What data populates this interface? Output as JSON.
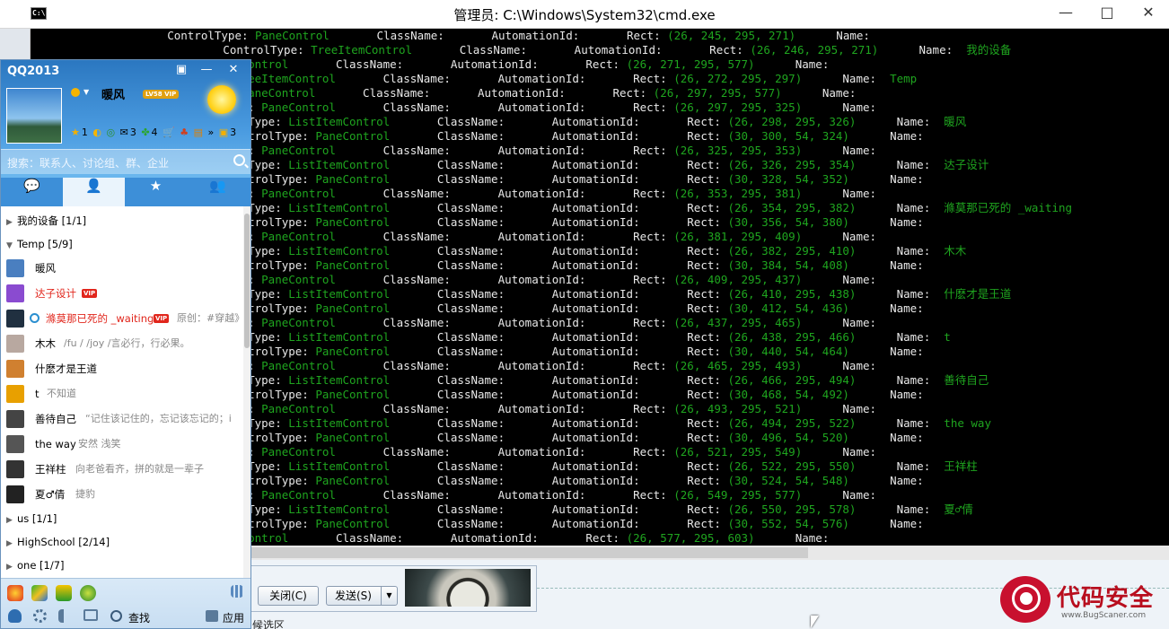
{
  "cmd": {
    "title": "管理员: C:\\Windows\\System32\\cmd.exe",
    "icon_text": "C:\\.",
    "minimize": "—",
    "maximize": "□",
    "close": "✕",
    "lines": [
      [
        [
          "w",
          "        ControlType: "
        ],
        [
          "g",
          "PaneControl"
        ],
        [
          "w",
          "       ClassName:       AutomationId:       Rect: "
        ],
        [
          "g",
          "(26, 245, 295, 271)"
        ],
        [
          "w",
          "      Name:"
        ]
      ],
      [
        [
          "w",
          "            ControlType: "
        ],
        [
          "g",
          "TreeItemControl"
        ],
        [
          "w",
          "       ClassName:       AutomationId:       Rect: "
        ],
        [
          "g",
          "(26, 246, 295, 271)"
        ],
        [
          "w",
          "      Name:  "
        ],
        [
          "g",
          "我的设备"
        ]
      ],
      [
        [
          "g",
          "aneControl"
        ],
        [
          "w",
          "       ClassName:       AutomationId:       Rect: "
        ],
        [
          "g",
          "(26, 271, 295, 577)"
        ],
        [
          "w",
          "      Name:"
        ]
      ],
      [
        [
          "w",
          ": "
        ],
        [
          "g",
          "TreeItemControl"
        ],
        [
          "w",
          "       ClassName:       AutomationId:       Rect: "
        ],
        [
          "g",
          "(26, 272, 295, 297)"
        ],
        [
          "w",
          "      Name:  "
        ],
        [
          "g",
          "Temp"
        ]
      ],
      [
        [
          "w",
          ":  "
        ],
        [
          "g",
          "PaneControl"
        ],
        [
          "w",
          "       ClassName:       AutomationId:       Rect: "
        ],
        [
          "g",
          "(26, 297, 295, 577)"
        ],
        [
          "w",
          "      Name:"
        ]
      ],
      [
        [
          "w",
          "Type: "
        ],
        [
          "g",
          "PaneControl"
        ],
        [
          "w",
          "       ClassName:       AutomationId:       Rect: "
        ],
        [
          "g",
          "(26, 297, 295, 325)"
        ],
        [
          "w",
          "      Name:"
        ]
      ],
      [
        [
          "w",
          "trolType: "
        ],
        [
          "g",
          "ListItemControl"
        ],
        [
          "w",
          "       ClassName:       AutomationId:       Rect: "
        ],
        [
          "g",
          "(26, 298, 295, 326)"
        ],
        [
          "w",
          "      Name:  "
        ],
        [
          "g",
          "暖风"
        ]
      ],
      [
        [
          "w",
          " ControlType: "
        ],
        [
          "g",
          "PaneControl"
        ],
        [
          "w",
          "       ClassName:       AutomationId:       Rect: "
        ],
        [
          "g",
          "(30, 300, 54, 324)"
        ],
        [
          "w",
          "      Name:"
        ]
      ],
      [
        [
          "w",
          "Type: "
        ],
        [
          "g",
          "PaneControl"
        ],
        [
          "w",
          "       ClassName:       AutomationId:       Rect: "
        ],
        [
          "g",
          "(26, 325, 295, 353)"
        ],
        [
          "w",
          "      Name:"
        ]
      ],
      [
        [
          "w",
          "trolType: "
        ],
        [
          "g",
          "ListItemControl"
        ],
        [
          "w",
          "       ClassName:       AutomationId:       Rect: "
        ],
        [
          "g",
          "(26, 326, 295, 354)"
        ],
        [
          "w",
          "      Name:  "
        ],
        [
          "g",
          "达子设计"
        ]
      ],
      [
        [
          "w",
          " ControlType: "
        ],
        [
          "g",
          "PaneControl"
        ],
        [
          "w",
          "       ClassName:       AutomationId:       Rect: "
        ],
        [
          "g",
          "(30, 328, 54, 352)"
        ],
        [
          "w",
          "      Name:"
        ]
      ],
      [
        [
          "w",
          "Type: "
        ],
        [
          "g",
          "PaneControl"
        ],
        [
          "w",
          "       ClassName:       AutomationId:       Rect: "
        ],
        [
          "g",
          "(26, 353, 295, 381)"
        ],
        [
          "w",
          "      Name:"
        ]
      ],
      [
        [
          "w",
          "trolType: "
        ],
        [
          "g",
          "ListItemControl"
        ],
        [
          "w",
          "       ClassName:       AutomationId:       Rect: "
        ],
        [
          "g",
          "(26, 354, 295, 382)"
        ],
        [
          "w",
          "      Name:  "
        ],
        [
          "g",
          "滌莫那已死的 _waiting"
        ]
      ],
      [
        [
          "w",
          " ControlType: "
        ],
        [
          "g",
          "PaneControl"
        ],
        [
          "w",
          "       ClassName:       AutomationId:       Rect: "
        ],
        [
          "g",
          "(30, 356, 54, 380)"
        ],
        [
          "w",
          "      Name:"
        ]
      ],
      [
        [
          "w",
          "Type: "
        ],
        [
          "g",
          "PaneControl"
        ],
        [
          "w",
          "       ClassName:       AutomationId:       Rect: "
        ],
        [
          "g",
          "(26, 381, 295, 409)"
        ],
        [
          "w",
          "      Name:"
        ]
      ],
      [
        [
          "w",
          "trolType: "
        ],
        [
          "g",
          "ListItemControl"
        ],
        [
          "w",
          "       ClassName:       AutomationId:       Rect: "
        ],
        [
          "g",
          "(26, 382, 295, 410)"
        ],
        [
          "w",
          "      Name:  "
        ],
        [
          "g",
          "木木"
        ]
      ],
      [
        [
          "w",
          " ControlType: "
        ],
        [
          "g",
          "PaneControl"
        ],
        [
          "w",
          "       ClassName:       AutomationId:       Rect: "
        ],
        [
          "g",
          "(30, 384, 54, 408)"
        ],
        [
          "w",
          "      Name:"
        ]
      ],
      [
        [
          "w",
          "Type: "
        ],
        [
          "g",
          "PaneControl"
        ],
        [
          "w",
          "       ClassName:       AutomationId:       Rect: "
        ],
        [
          "g",
          "(26, 409, 295, 437)"
        ],
        [
          "w",
          "      Name:"
        ]
      ],
      [
        [
          "w",
          "trolType: "
        ],
        [
          "g",
          "ListItemControl"
        ],
        [
          "w",
          "       ClassName:       AutomationId:       Rect: "
        ],
        [
          "g",
          "(26, 410, 295, 438)"
        ],
        [
          "w",
          "      Name:  "
        ],
        [
          "g",
          "什麽才是王道"
        ]
      ],
      [
        [
          "w",
          " ControlType: "
        ],
        [
          "g",
          "PaneControl"
        ],
        [
          "w",
          "       ClassName:       AutomationId:       Rect: "
        ],
        [
          "g",
          "(30, 412, 54, 436)"
        ],
        [
          "w",
          "      Name:"
        ]
      ],
      [
        [
          "w",
          "Type: "
        ],
        [
          "g",
          "PaneControl"
        ],
        [
          "w",
          "       ClassName:       AutomationId:       Rect: "
        ],
        [
          "g",
          "(26, 437, 295, 465)"
        ],
        [
          "w",
          "      Name:"
        ]
      ],
      [
        [
          "w",
          "trolType: "
        ],
        [
          "g",
          "ListItemControl"
        ],
        [
          "w",
          "       ClassName:       AutomationId:       Rect: "
        ],
        [
          "g",
          "(26, 438, 295, 466)"
        ],
        [
          "w",
          "      Name:  "
        ],
        [
          "g",
          "t"
        ]
      ],
      [
        [
          "w",
          " ControlType: "
        ],
        [
          "g",
          "PaneControl"
        ],
        [
          "w",
          "       ClassName:       AutomationId:       Rect: "
        ],
        [
          "g",
          "(30, 440, 54, 464)"
        ],
        [
          "w",
          "      Name:"
        ]
      ],
      [
        [
          "w",
          "Type: "
        ],
        [
          "g",
          "PaneControl"
        ],
        [
          "w",
          "       ClassName:       AutomationId:       Rect: "
        ],
        [
          "g",
          "(26, 465, 295, 493)"
        ],
        [
          "w",
          "      Name:"
        ]
      ],
      [
        [
          "w",
          "trolType: "
        ],
        [
          "g",
          "ListItemControl"
        ],
        [
          "w",
          "       ClassName:       AutomationId:       Rect: "
        ],
        [
          "g",
          "(26, 466, 295, 494)"
        ],
        [
          "w",
          "      Name:  "
        ],
        [
          "g",
          "善待自己"
        ]
      ],
      [
        [
          "w",
          " ControlType: "
        ],
        [
          "g",
          "PaneControl"
        ],
        [
          "w",
          "       ClassName:       AutomationId:       Rect: "
        ],
        [
          "g",
          "(30, 468, 54, 492)"
        ],
        [
          "w",
          "      Name:"
        ]
      ],
      [
        [
          "w",
          "Type: "
        ],
        [
          "g",
          "PaneControl"
        ],
        [
          "w",
          "       ClassName:       AutomationId:       Rect: "
        ],
        [
          "g",
          "(26, 493, 295, 521)"
        ],
        [
          "w",
          "      Name:"
        ]
      ],
      [
        [
          "w",
          "trolType: "
        ],
        [
          "g",
          "ListItemControl"
        ],
        [
          "w",
          "       ClassName:       AutomationId:       Rect: "
        ],
        [
          "g",
          "(26, 494, 295, 522)"
        ],
        [
          "w",
          "      Name:  "
        ],
        [
          "g",
          "the way"
        ]
      ],
      [
        [
          "w",
          " ControlType: "
        ],
        [
          "g",
          "PaneControl"
        ],
        [
          "w",
          "       ClassName:       AutomationId:       Rect: "
        ],
        [
          "g",
          "(30, 496, 54, 520)"
        ],
        [
          "w",
          "      Name:"
        ]
      ],
      [
        [
          "w",
          "Type: "
        ],
        [
          "g",
          "PaneControl"
        ],
        [
          "w",
          "       ClassName:       AutomationId:       Rect: "
        ],
        [
          "g",
          "(26, 521, 295, 549)"
        ],
        [
          "w",
          "      Name:"
        ]
      ],
      [
        [
          "w",
          "trolType: "
        ],
        [
          "g",
          "ListItemControl"
        ],
        [
          "w",
          "       ClassName:       AutomationId:       Rect: "
        ],
        [
          "g",
          "(26, 522, 295, 550)"
        ],
        [
          "w",
          "      Name:  "
        ],
        [
          "g",
          "王祥柱"
        ]
      ],
      [
        [
          "w",
          " ControlType: "
        ],
        [
          "g",
          "PaneControl"
        ],
        [
          "w",
          "       ClassName:       AutomationId:       Rect: "
        ],
        [
          "g",
          "(30, 524, 54, 548)"
        ],
        [
          "w",
          "      Name:"
        ]
      ],
      [
        [
          "w",
          "Type: "
        ],
        [
          "g",
          "PaneControl"
        ],
        [
          "w",
          "       ClassName:       AutomationId:       Rect: "
        ],
        [
          "g",
          "(26, 549, 295, 577)"
        ],
        [
          "w",
          "      Name:"
        ]
      ],
      [
        [
          "w",
          "trolType: "
        ],
        [
          "g",
          "ListItemControl"
        ],
        [
          "w",
          "       ClassName:       AutomationId:       Rect: "
        ],
        [
          "g",
          "(26, 550, 295, 578)"
        ],
        [
          "w",
          "      Name:  "
        ],
        [
          "g",
          "夏♂倩"
        ]
      ],
      [
        [
          "w",
          " ControlType: "
        ],
        [
          "g",
          "PaneControl"
        ],
        [
          "w",
          "       ClassName:       AutomationId:       Rect: "
        ],
        [
          "g",
          "(30, 552, 54, 576)"
        ],
        [
          "w",
          "      Name:"
        ]
      ],
      [
        [
          "g",
          "aneControl"
        ],
        [
          "w",
          "       ClassName:       AutomationId:       Rect: "
        ],
        [
          "g",
          "(26, 577, 295, 603)"
        ],
        [
          "w",
          "      Name:"
        ]
      ]
    ]
  },
  "qq": {
    "app_name": "QQ2013",
    "user_name": "暖风",
    "svip_badge": "LV58 VIP",
    "toolbar_counts": [
      "1",
      "3",
      "4",
      "3"
    ],
    "search_placeholder": "搜索：联系人、讨论组、群、企业",
    "tabs": [
      "💬",
      "👤",
      "★",
      "👥"
    ],
    "groups": {
      "my_devices": "我的设备   [1/1]",
      "temp": "Temp   [5/9]",
      "us": "us   [1/1]",
      "highschool": "HighSchool   [2/14]",
      "one": "one   [1/7]"
    },
    "friends": [
      {
        "name": "暖风",
        "signature": "",
        "vip": "",
        "color": "#4a7fc0"
      },
      {
        "name": "达子设计",
        "signature": "",
        "vip": "VIP",
        "color": "#8a4bd0"
      },
      {
        "name": "滌莫那已死的 _waiting",
        "signature": "原创：#穿越》",
        "vip": "VIP",
        "color": "#203040"
      },
      {
        "name": "木木",
        "signature": "/fu / /joy /言必行，行必果。",
        "vip": "",
        "color": "#b8a8a0"
      },
      {
        "name": "什麽才是王道",
        "signature": "",
        "vip": "",
        "color": "#d08030"
      },
      {
        "name": "t",
        "signature": "不知道",
        "vip": "",
        "color": "#e8a000"
      },
      {
        "name": "善待自己",
        "signature": "“记住该记住的，忘记该忘记的；i",
        "vip": "",
        "color": "#444"
      },
      {
        "name": "the way",
        "signature": "安然 浅笑",
        "vip": "",
        "color": "#555"
      },
      {
        "name": "王祥柱",
        "signature": "向老爸看齐，拼的就是一辈子",
        "vip": "",
        "color": "#333"
      },
      {
        "name": "夏♂倩",
        "signature": "捷豹",
        "vip": "",
        "color": "#222"
      }
    ],
    "bottom": {
      "find": "查找",
      "app": "应用"
    }
  },
  "chat": {
    "close_button": "关闭(C)",
    "send_button": "发送(S)",
    "bottom_text": "候选区"
  },
  "watermark": {
    "text": "代码安全",
    "url": "www.BugScaner.com"
  }
}
